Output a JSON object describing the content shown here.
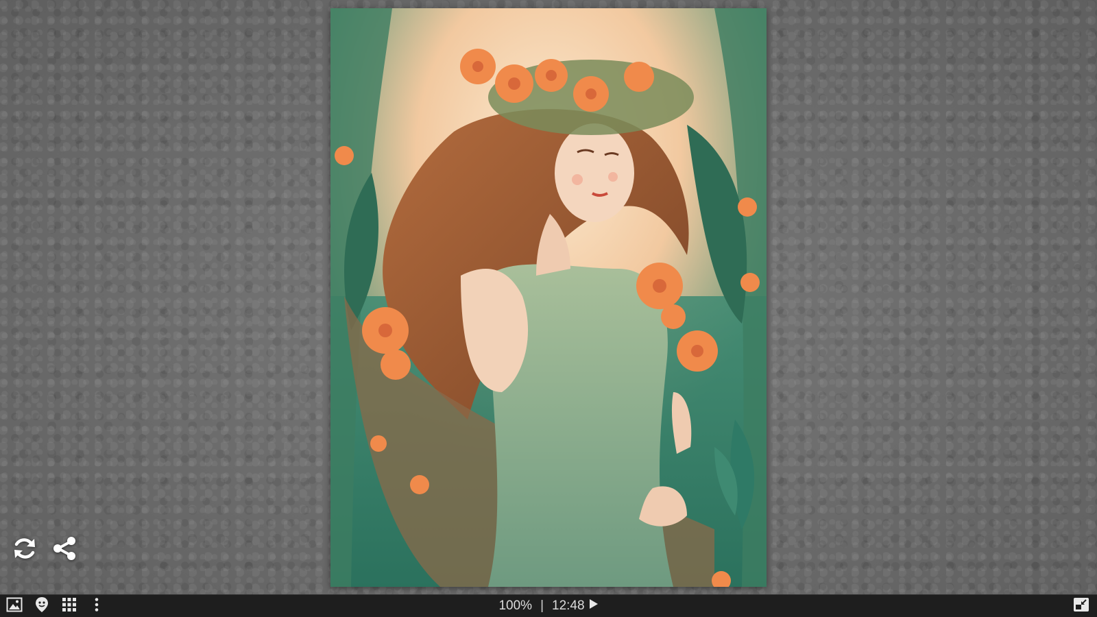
{
  "viewer": {
    "zoom": "100%",
    "separator": "|",
    "time": "12:48"
  },
  "artwork": {
    "colors": {
      "background_green": "#2f7a66",
      "sky_peach": "#f5d9b8",
      "hair": "#9a5a34",
      "dress": "#8fae8c",
      "skin": "#f2d2b8",
      "flower_orange": "#f08a4b"
    }
  },
  "icons": {
    "refresh": "refresh-icon",
    "share": "share-icon",
    "image": "image-icon",
    "location": "location-icon",
    "grid": "grid-icon",
    "more": "more-vertical-icon",
    "play": "play-icon",
    "exit_fullscreen": "exit-fullscreen-icon"
  }
}
